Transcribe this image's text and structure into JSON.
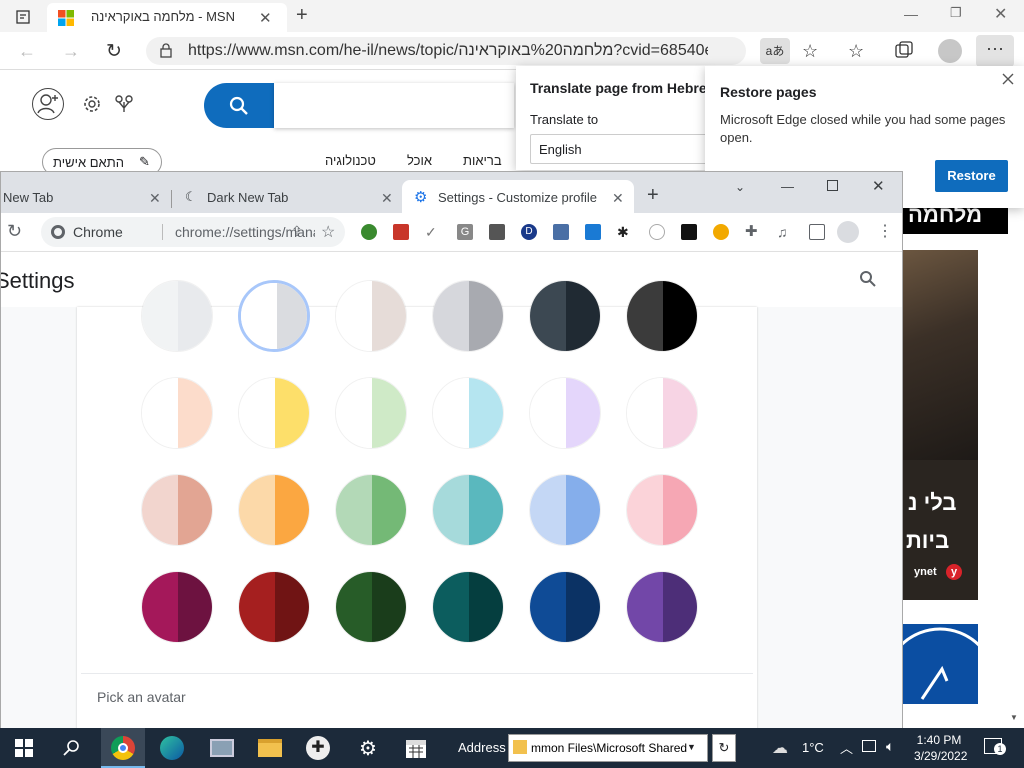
{
  "edge": {
    "tab_title": "מלחמה באוקראינה - MSN",
    "url": "https://www.msn.com/he-il/news/topic/מלחמה%20באוקראינה?cvid=68540eb...",
    "read_aloud": "aあ"
  },
  "msn": {
    "personalize_label": "התאם אישית",
    "nav_items": [
      "בריאות",
      "אוכל",
      "טכנולוגיה"
    ],
    "black_bar_text": "מלחמה",
    "headline_1": "בלי נ",
    "headline_2": "ביות",
    "source": "ynet",
    "source_logo": "y"
  },
  "translate": {
    "title": "Translate page from Hebrew",
    "label": "Translate to",
    "language": "English"
  },
  "restore": {
    "title": "Restore pages",
    "message": "Microsoft Edge closed while you had some pages open.",
    "button": "Restore"
  },
  "chrome": {
    "tabs": [
      {
        "label": "New Tab"
      },
      {
        "label": "Dark New Tab"
      },
      {
        "label": "Settings - Customize profile"
      }
    ],
    "site_label": "Chrome",
    "url_path": "chrome://settings/manageProfile",
    "page_title": "Settings",
    "avatar_label": "Pick an avatar"
  },
  "swatches": [
    [
      [
        "#f1f3f4",
        "#e8eaed"
      ],
      [
        "#ffffff",
        "#dadce0"
      ],
      [
        "#ffffff",
        "#e6dcd8"
      ],
      [
        "#d6d7dc",
        "#a8aab0"
      ],
      [
        "#3c4852",
        "#202a33"
      ],
      [
        "#3b3b3b",
        "#000000"
      ]
    ],
    [
      [
        "#ffffff",
        "#fcdccb"
      ],
      [
        "#ffffff",
        "#fddf6a"
      ],
      [
        "#ffffff",
        "#cfeac7"
      ],
      [
        "#ffffff",
        "#b5e5f0"
      ],
      [
        "#ffffff",
        "#e4d6fb"
      ],
      [
        "#ffffff",
        "#f7d4e4"
      ]
    ],
    [
      [
        "#f2d5ce",
        "#e2a593"
      ],
      [
        "#fcd9a9",
        "#fba741"
      ],
      [
        "#b3d9b7",
        "#74b976"
      ],
      [
        "#a6dadb",
        "#5ab8be"
      ],
      [
        "#c4d7f5",
        "#85aeeb"
      ],
      [
        "#fbd3d9",
        "#f6a7b4"
      ]
    ],
    [
      [
        "#a4185a",
        "#6d1240"
      ],
      [
        "#a51f1f",
        "#701414"
      ],
      [
        "#275c28",
        "#1a3d1b"
      ],
      [
        "#0c5d5e",
        "#053e3f"
      ],
      [
        "#0f4b96",
        "#0b3264"
      ],
      [
        "#7247a8",
        "#4d2e78"
      ]
    ]
  ],
  "taskbar": {
    "address_label": "Address",
    "address_value": "mmon Files\\Microsoft Shared",
    "temperature": "1°C",
    "time": "1:40 PM",
    "date": "3/29/2022",
    "notification_count": "1"
  }
}
